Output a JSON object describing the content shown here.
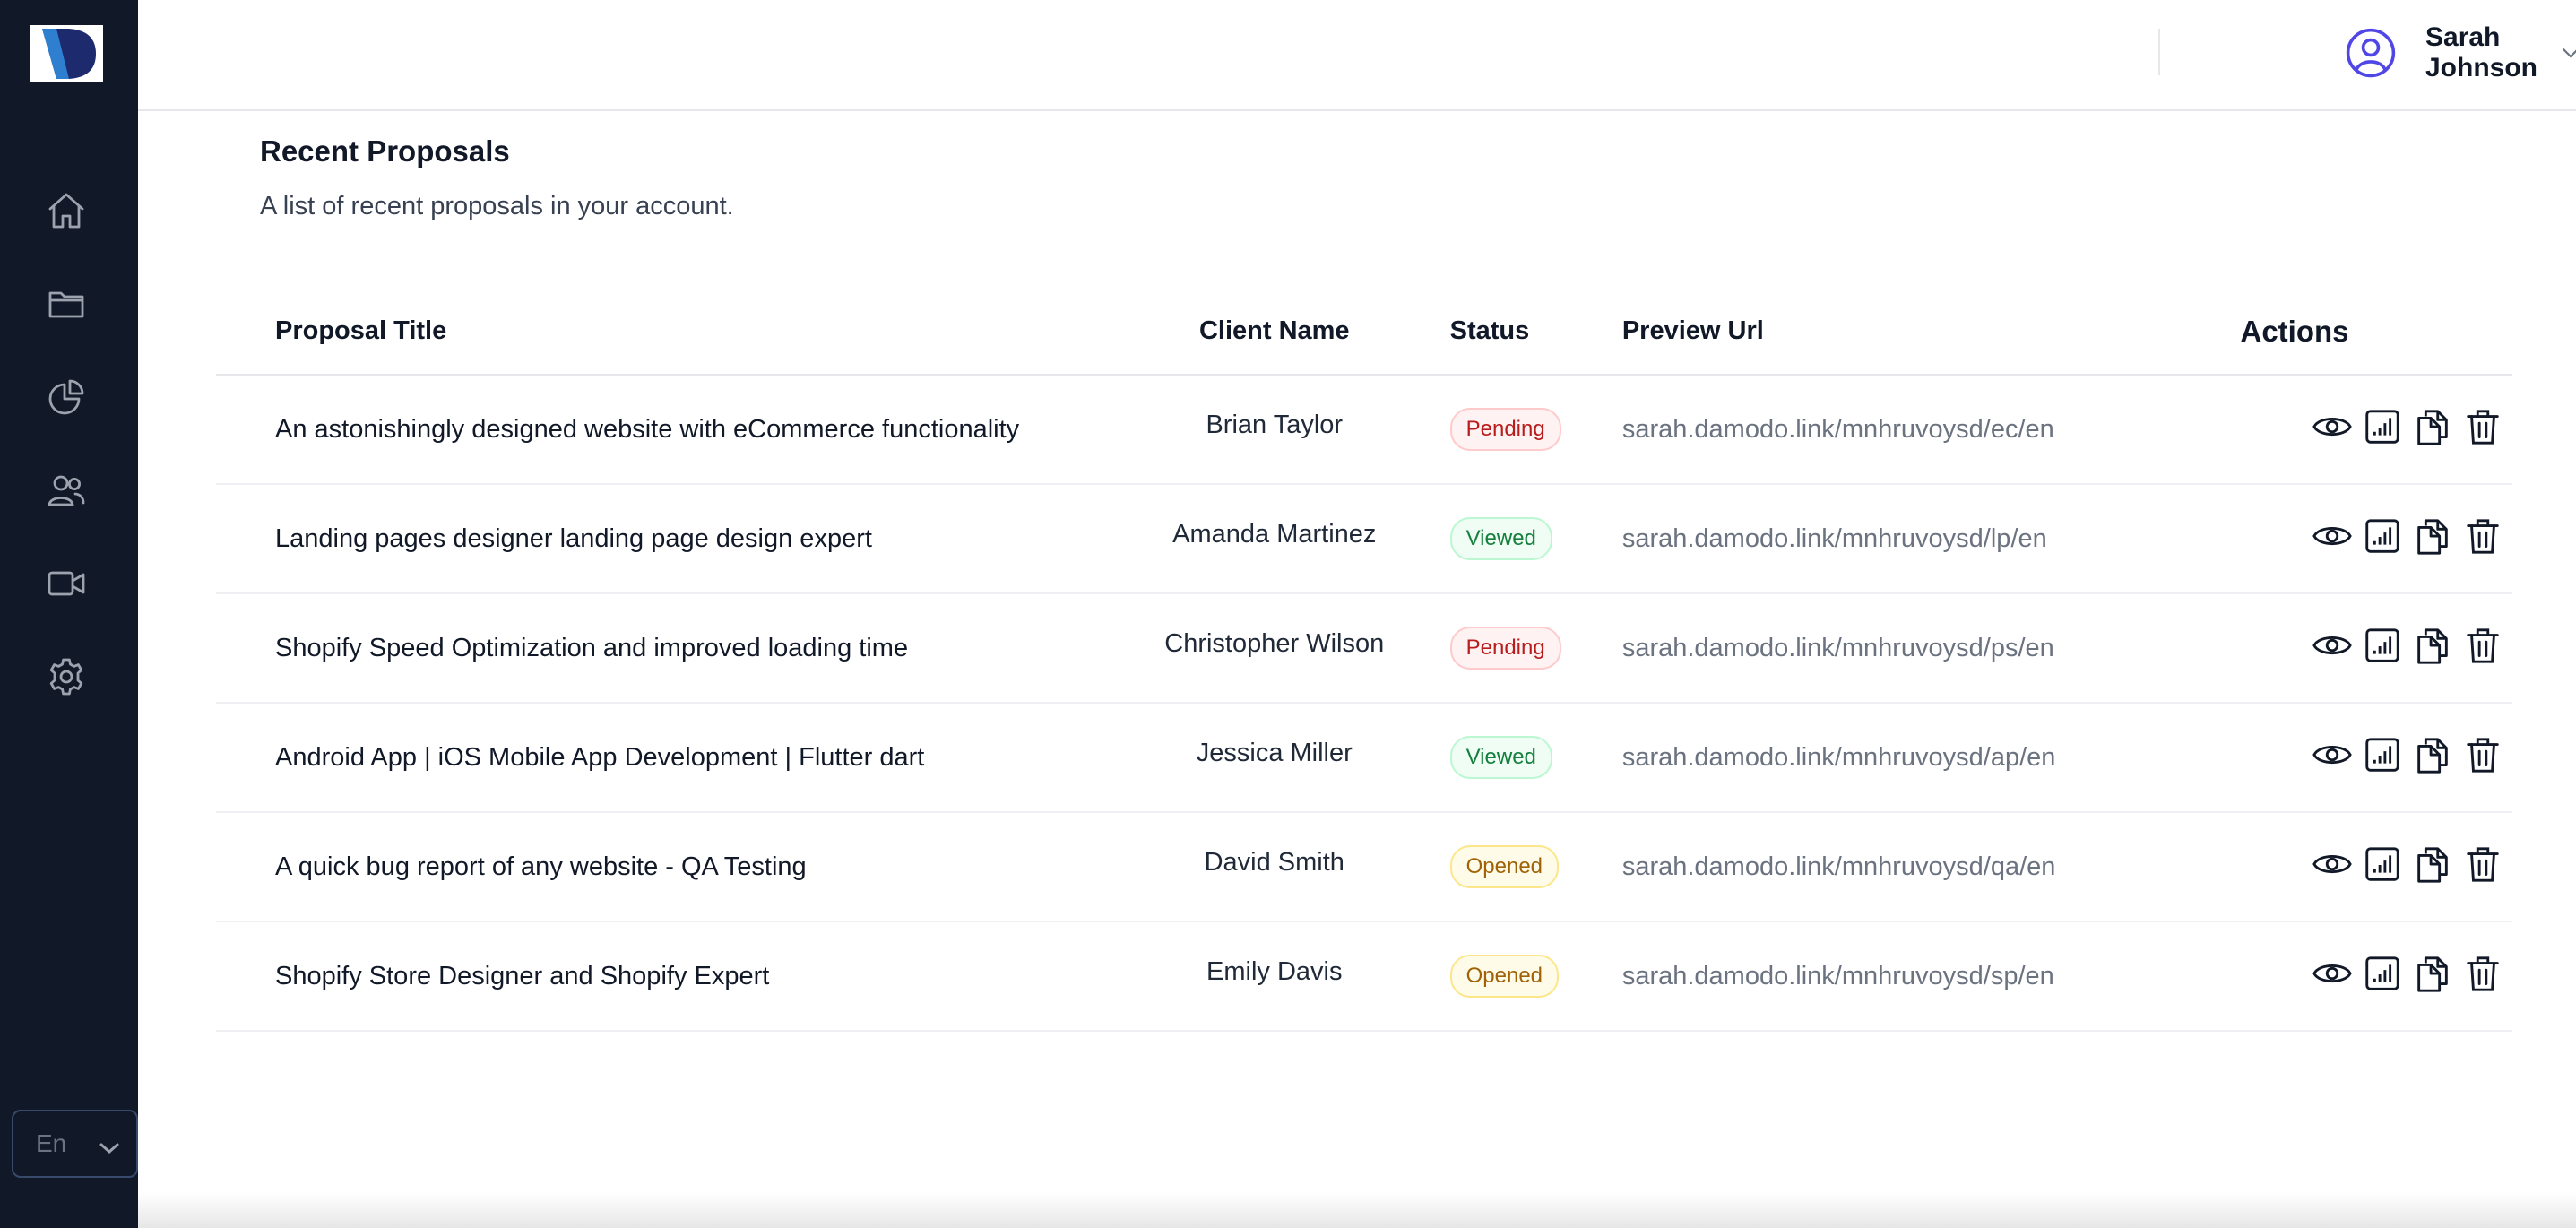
{
  "sidebar": {
    "logo": "damodo-logo",
    "nav": [
      {
        "icon": "home-icon"
      },
      {
        "icon": "folder-icon"
      },
      {
        "icon": "pie-chart-icon"
      },
      {
        "icon": "users-icon"
      },
      {
        "icon": "video-icon"
      },
      {
        "icon": "gear-icon"
      }
    ],
    "language": "En"
  },
  "header": {
    "user_name": "Sarah Johnson",
    "avatar_icon": "user-circle-icon"
  },
  "main": {
    "title": "Recent Proposals",
    "description": "A list of recent proposals in your account.",
    "columns": {
      "title": "Proposal Title",
      "client": "Client Name",
      "status": "Status",
      "url": "Preview Url",
      "actions": "Actions"
    },
    "rows": [
      {
        "title": "An astonishingly designed website with eCommerce functionality",
        "client": "Brian Taylor",
        "status": "Pending",
        "status_type": "pending",
        "url": "sarah.damodo.link/mnhruvoysd/ec/en"
      },
      {
        "title": "Landing pages designer landing page design expert",
        "client": "Amanda Martinez",
        "status": "Viewed",
        "status_type": "viewed",
        "url": "sarah.damodo.link/mnhruvoysd/lp/en"
      },
      {
        "title": "Shopify Speed Optimization and improved loading time",
        "client": "Christopher Wilson",
        "status": "Pending",
        "status_type": "pending",
        "url": "sarah.damodo.link/mnhruvoysd/ps/en"
      },
      {
        "title": "Android App | iOS Mobile App Development | Flutter dart",
        "client": "Jessica Miller",
        "status": "Viewed",
        "status_type": "viewed",
        "url": "sarah.damodo.link/mnhruvoysd/ap/en"
      },
      {
        "title": "A quick bug report of any website - QA Testing",
        "client": "David Smith",
        "status": "Opened",
        "status_type": "opened",
        "url": "sarah.damodo.link/mnhruvoysd/qa/en"
      },
      {
        "title": "Shopify Store Designer and Shopify Expert",
        "client": "Emily Davis",
        "status": "Opened",
        "status_type": "opened",
        "url": "sarah.damodo.link/mnhruvoysd/sp/en"
      }
    ],
    "row_actions": [
      "eye-icon",
      "stats-icon",
      "copy-icon",
      "trash-icon"
    ]
  },
  "colors": {
    "sidebar_bg": "#111827",
    "accent": "#4f46e5",
    "pending": "#b91c1c",
    "viewed": "#15803d",
    "opened": "#a16207"
  }
}
